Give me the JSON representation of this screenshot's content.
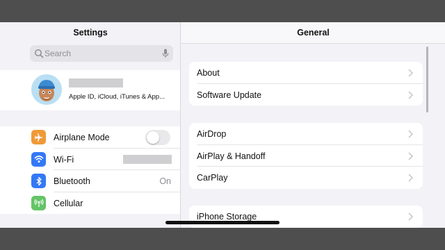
{
  "sidebar": {
    "title": "Settings",
    "search_placeholder": "Search",
    "profile": {
      "subtitle": "Apple ID, iCloud, iTunes & App..."
    },
    "items": [
      {
        "label": "Airplane Mode",
        "icon": "airplane-icon",
        "color": "#f09a37",
        "toggle": false
      },
      {
        "label": "Wi-Fi",
        "icon": "wifi-icon",
        "color": "#3478f6"
      },
      {
        "label": "Bluetooth",
        "icon": "bluetooth-icon",
        "color": "#3478f6",
        "value": "On"
      },
      {
        "label": "Cellular",
        "icon": "cellular-icon",
        "color": "#65c466"
      }
    ]
  },
  "main": {
    "title": "General",
    "groups": [
      {
        "items": [
          "About",
          "Software Update"
        ]
      },
      {
        "items": [
          "AirDrop",
          "AirPlay & Handoff",
          "CarPlay"
        ]
      },
      {
        "items": [
          "iPhone Storage"
        ]
      }
    ]
  }
}
